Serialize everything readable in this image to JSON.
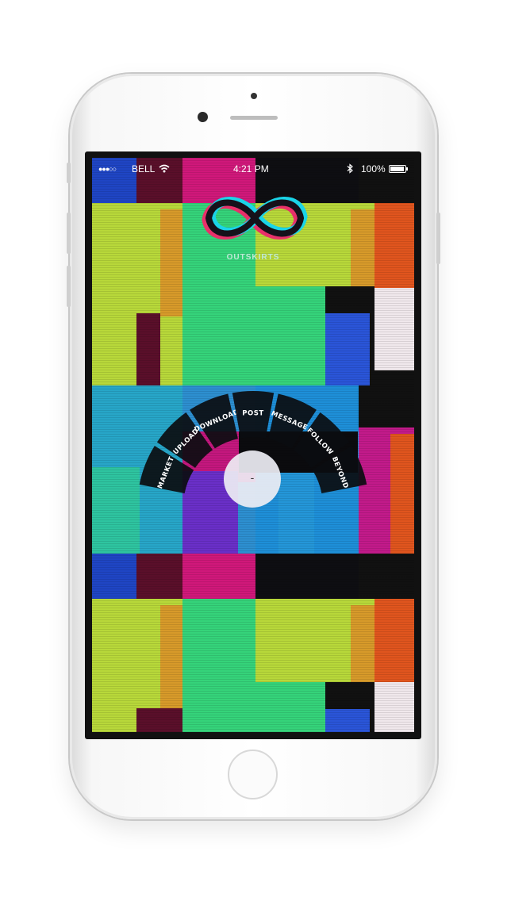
{
  "status_bar": {
    "carrier": "BELL",
    "signal": "●●●○○",
    "time": "4:21 PM",
    "battery": "100%",
    "icons": [
      "wifi-icon",
      "bluetooth-icon",
      "battery-icon"
    ]
  },
  "app": {
    "logo": "infinity-icon",
    "name": "OUTSKIRTS"
  },
  "radial_menu": {
    "items": [
      "MARKET",
      "UPLOAD",
      "DOWNLOAD",
      "POST",
      "MESSAGE",
      "FOLLOW",
      "BEYOND"
    ],
    "center_label": "-"
  },
  "colors": {
    "lime": "#b8d83a",
    "green": "#35d37a",
    "magenta": "#d0187a",
    "blue": "#1a4fd8",
    "orange": "#e0551e",
    "cyan": "#27a6c8",
    "menu_segment": "#0b0d10"
  }
}
